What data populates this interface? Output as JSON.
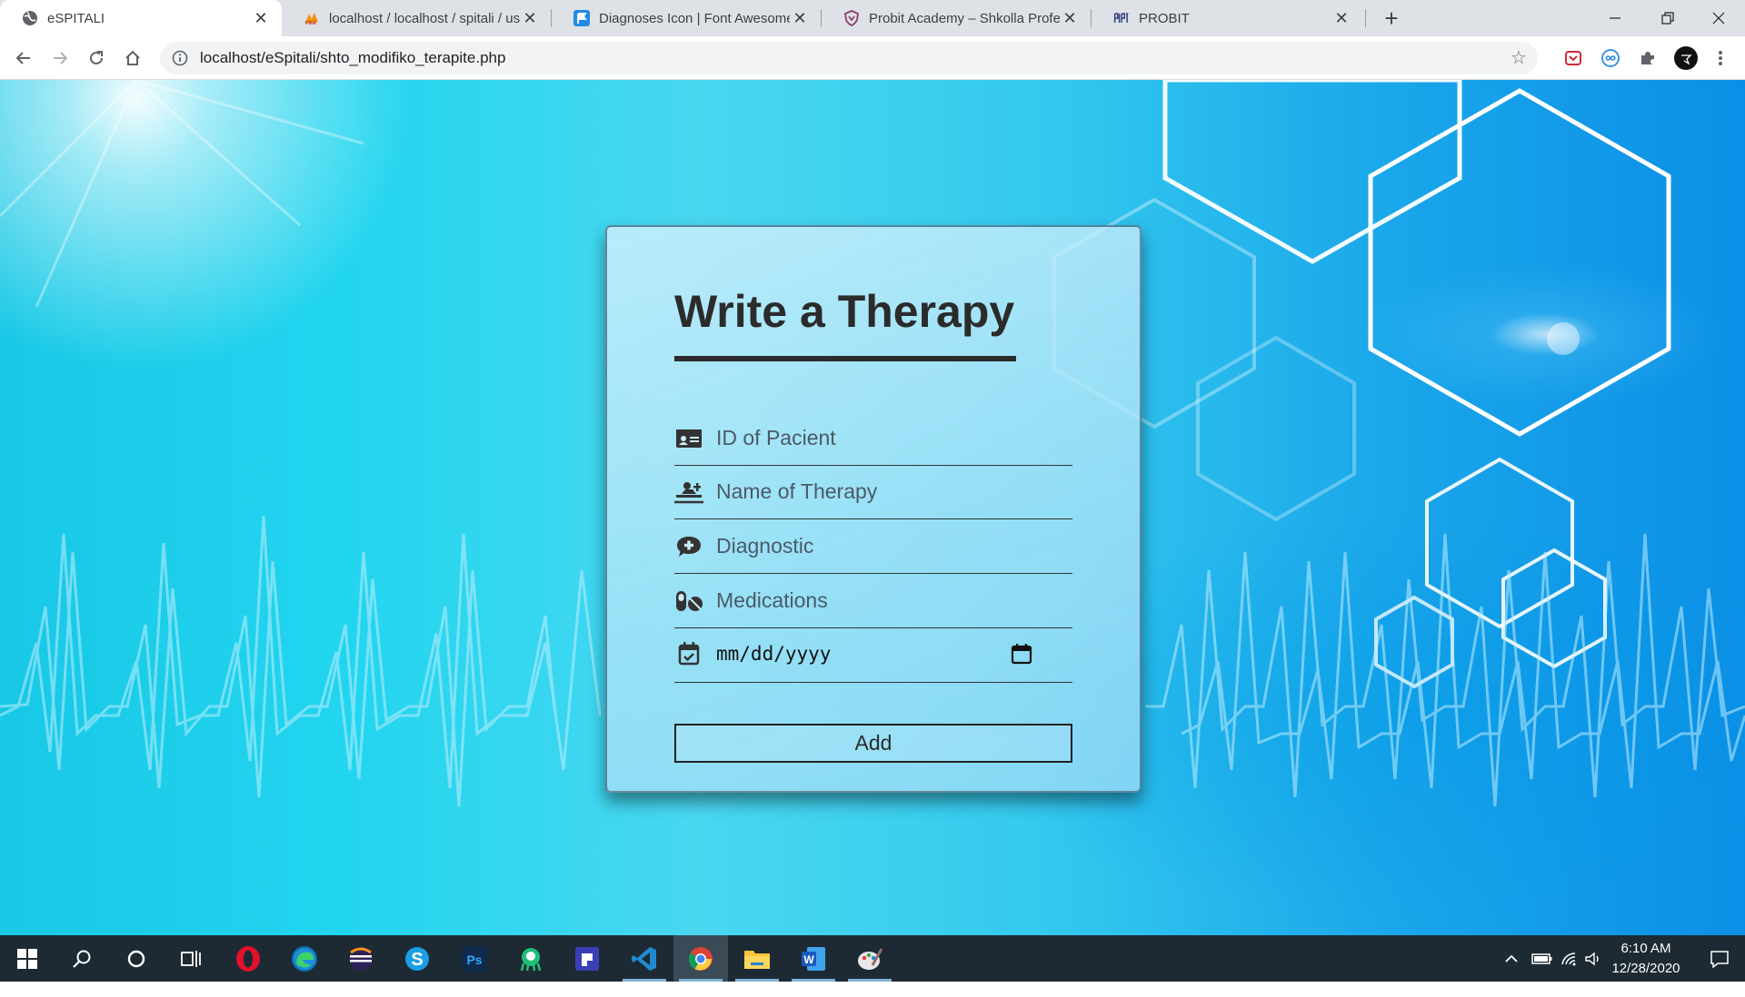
{
  "browser": {
    "tabs": [
      {
        "title": "eSPITALI",
        "favicon": "globe-icon",
        "active": true
      },
      {
        "title": "localhost / localhost / spitali / us",
        "favicon": "phpmyadmin-icon",
        "active": false
      },
      {
        "title": "Diagnoses Icon | Font Awesome",
        "favicon": "font-awesome-flag-icon",
        "active": false
      },
      {
        "title": "Probit Academy – Shkolla Profesi",
        "favicon": "probit-shield-icon",
        "active": false
      },
      {
        "title": "PROBIT",
        "favicon": "probit-logo-icon",
        "active": false
      }
    ],
    "url": "localhost/eSpitali/shto_modifiko_terapite.php"
  },
  "form": {
    "title": "Write a Therapy",
    "fields": [
      {
        "placeholder": "ID of Pacient",
        "icon": "id-card-icon"
      },
      {
        "placeholder": "Name of Therapy",
        "icon": "procedures-icon"
      },
      {
        "placeholder": "Diagnostic",
        "icon": "comment-medical-icon"
      },
      {
        "placeholder": "Medications",
        "icon": "pills-icon"
      }
    ],
    "date": {
      "placeholder": "mm/dd/yyyy",
      "icon": "calendar-check-icon"
    },
    "submit_label": "Add"
  },
  "taskbar": {
    "time": "6:10 AM",
    "date": "12/28/2020"
  },
  "colors": {
    "tabstrip": "#dee1e6",
    "taskbar": "#1d2a33",
    "card_border": "#283c50",
    "text_dark": "#2b2b2b"
  }
}
